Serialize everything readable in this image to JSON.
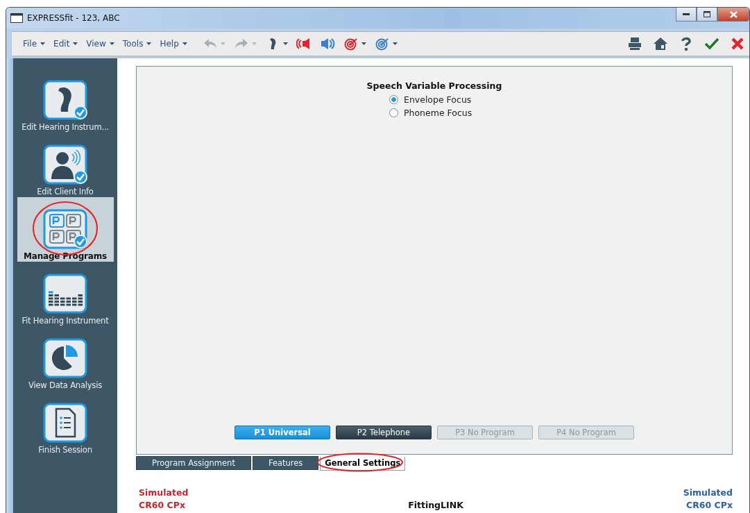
{
  "window": {
    "title": "EXPRESSfit - 123, ABC"
  },
  "menu": [
    {
      "label": "File"
    },
    {
      "label": "Edit"
    },
    {
      "label": "View"
    },
    {
      "label": "Tools"
    },
    {
      "label": "Help"
    }
  ],
  "toolbar": [
    {
      "kind": "undo",
      "disabled": true,
      "dropdown": true
    },
    {
      "kind": "redo",
      "disabled": true,
      "dropdown": true
    },
    {
      "kind": "hearing-aid",
      "disabled": false,
      "dropdown": true
    },
    {
      "kind": "left-speaker",
      "disabled": false,
      "dropdown": false
    },
    {
      "kind": "right-speaker",
      "disabled": false,
      "dropdown": false
    },
    {
      "kind": "left-target",
      "disabled": false,
      "dropdown": true
    },
    {
      "kind": "right-target",
      "disabled": false,
      "dropdown": true
    }
  ],
  "toolbar_right": [
    {
      "kind": "print"
    },
    {
      "kind": "home"
    },
    {
      "kind": "help"
    },
    {
      "kind": "accept"
    },
    {
      "kind": "cancel"
    }
  ],
  "sidebar": {
    "items": [
      {
        "kind": "hearing-aid",
        "label": "Edit Hearing Instrum...",
        "done": true,
        "selected": false,
        "circled": false
      },
      {
        "kind": "client",
        "label": "Edit Client Info",
        "done": true,
        "selected": false,
        "circled": false
      },
      {
        "kind": "programs",
        "label": "Manage Programs",
        "done": true,
        "selected": true,
        "circled": true
      },
      {
        "kind": "fit",
        "label": "Fit Hearing Instrument",
        "done": false,
        "selected": false,
        "circled": false
      },
      {
        "kind": "analysis",
        "label": "View Data Analysis",
        "done": false,
        "selected": false,
        "circled": false
      },
      {
        "kind": "finish",
        "label": "Finish Session",
        "done": false,
        "selected": false,
        "circled": false
      }
    ]
  },
  "settings": {
    "heading": "Speech Variable Processing",
    "options": [
      {
        "label": "Envelope Focus",
        "selected": true
      },
      {
        "label": "Phoneme Focus",
        "selected": false
      }
    ]
  },
  "programs": [
    {
      "label": "P1 Universal",
      "selected": true,
      "disabled": false
    },
    {
      "label": "P2 Telephone",
      "selected": false,
      "disabled": false
    },
    {
      "label": "P3 No Program",
      "selected": false,
      "disabled": true
    },
    {
      "label": "P4 No Program",
      "selected": false,
      "disabled": true
    }
  ],
  "tabs": [
    {
      "label": "Program Assignment",
      "selected": false,
      "circled": false
    },
    {
      "label": "Features",
      "selected": false,
      "circled": false
    },
    {
      "label": "General Settings",
      "selected": true,
      "circled": true
    }
  ],
  "footer": {
    "left": {
      "lines": [
        "Simulated",
        "CR60 CPx"
      ],
      "color": "#c0282d"
    },
    "center": "FittingLINK",
    "right": {
      "lines": [
        "Simulated",
        "CR60 CPx"
      ],
      "color": "#2f5fa8"
    }
  }
}
